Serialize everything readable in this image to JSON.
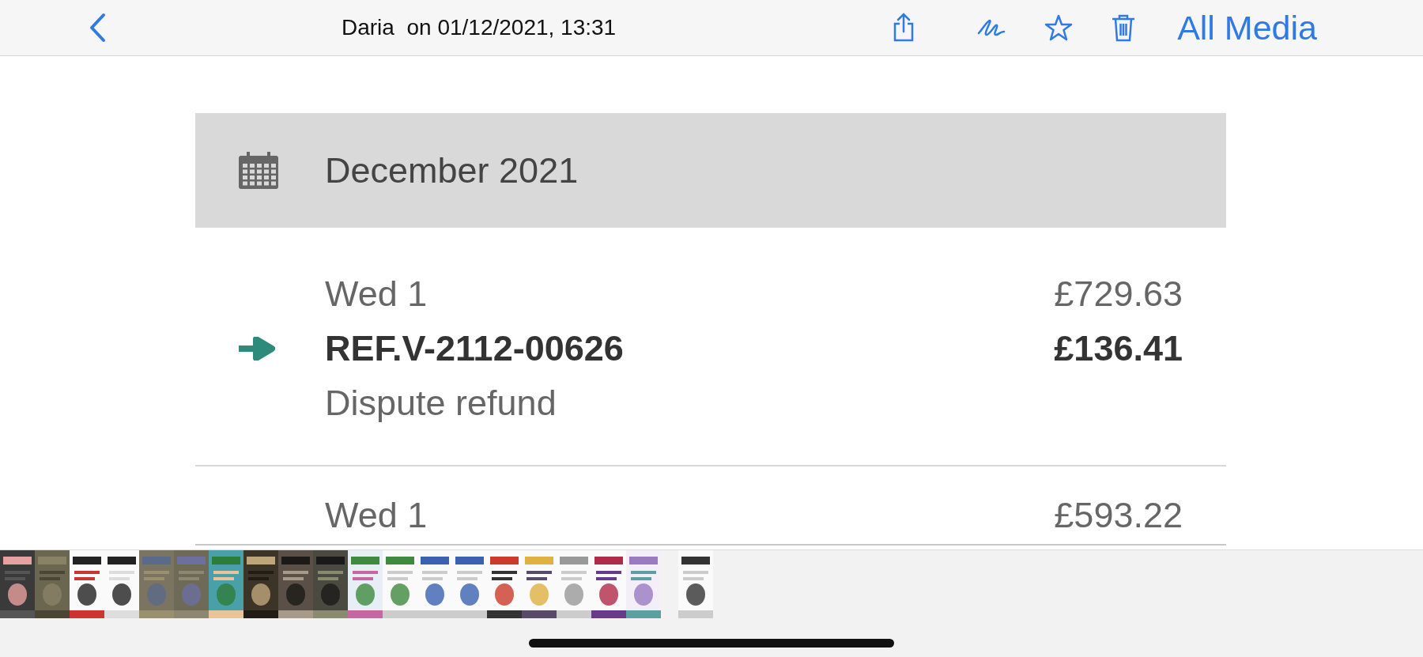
{
  "nav_bar": {
    "title": "Daria  on 01/12/2021, 13:31",
    "done_label": "All Media"
  },
  "statement": {
    "month_header": {
      "label": "December 2021"
    },
    "transactions": [
      {
        "day": "Wed 1",
        "balance": "£729.63",
        "reference": "REF.V-2112-00626",
        "amount": "£136.41",
        "description": "Dispute refund",
        "kind": "incoming"
      }
    ],
    "next_row": {
      "day": "Wed 1",
      "balance": "£593.22"
    }
  }
}
